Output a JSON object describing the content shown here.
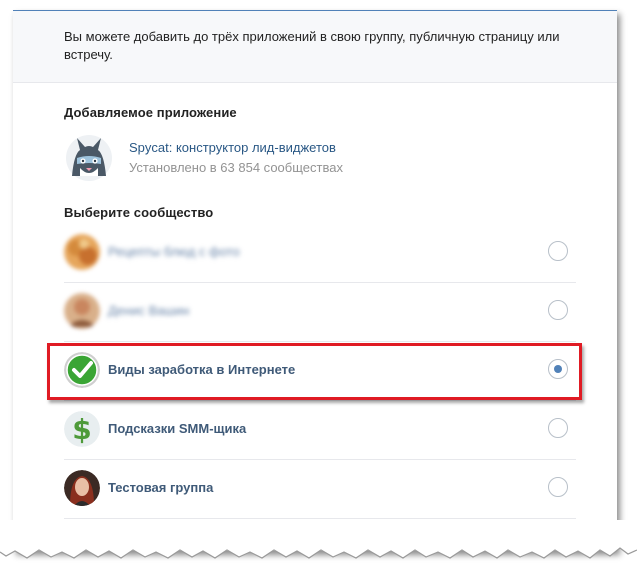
{
  "info": {
    "text": "Вы можете добавить до трёх приложений в свою группу, публичную страницу или встречу."
  },
  "app_section": {
    "title": "Добавляемое приложение",
    "app_name": "Spycat: конструктор лид-виджетов",
    "app_installs": "Установлено в 63 854 сообществах",
    "icon": "spycat-cat-logo"
  },
  "community_section": {
    "title": "Выберите сообщество",
    "groups": [
      {
        "name": "Рецепты блюд с фото",
        "blurred": true,
        "selected": false,
        "icon": "food-avatar"
      },
      {
        "name": "Денис Вашин",
        "blurred": true,
        "selected": false,
        "icon": "person-avatar"
      },
      {
        "name": "Виды заработка в Интернете",
        "blurred": false,
        "selected": true,
        "icon": "green-check-avatar"
      },
      {
        "name": "Подсказки SMM-щика",
        "blurred": false,
        "selected": false,
        "icon": "dollar-sign-avatar"
      },
      {
        "name": "Тестовая группа",
        "blurred": false,
        "selected": false,
        "icon": "woman-portrait-avatar"
      }
    ]
  },
  "colors": {
    "link": "#2a5885",
    "accent": "#5181b8",
    "highlight": "#e01b24"
  }
}
